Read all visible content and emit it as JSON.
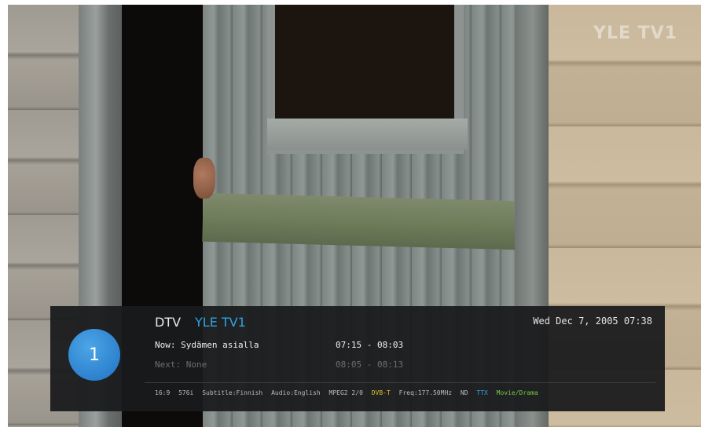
{
  "watermark": "YLE TV1",
  "banner": {
    "channel_number": "1",
    "source": "DTV",
    "channel_name": "YLE TV1",
    "datetime": "Wed Dec 7, 2005 07:38",
    "now": {
      "label": "Now: Sydämen asialla",
      "time": "07:15 - 08:03"
    },
    "next": {
      "label": "Next: None",
      "time": "08:05 - 08:13"
    },
    "status": {
      "aspect": "16:9",
      "resolution": "576i",
      "subtitle": "Subtitle:Finnish",
      "audio": "Audio:English",
      "codec": "MPEG2 2/0",
      "standard": "DVB-T",
      "freq": "Freq:177.50MHz",
      "nd": "ND",
      "ttx": "TTX",
      "genre": "Movie/Drama"
    }
  },
  "colors": {
    "accent_blue": "#2fa3e0",
    "badge_blue": "#1f73c4",
    "dvbt_yellow": "#d8c02a",
    "genre_green": "#7ac943"
  }
}
